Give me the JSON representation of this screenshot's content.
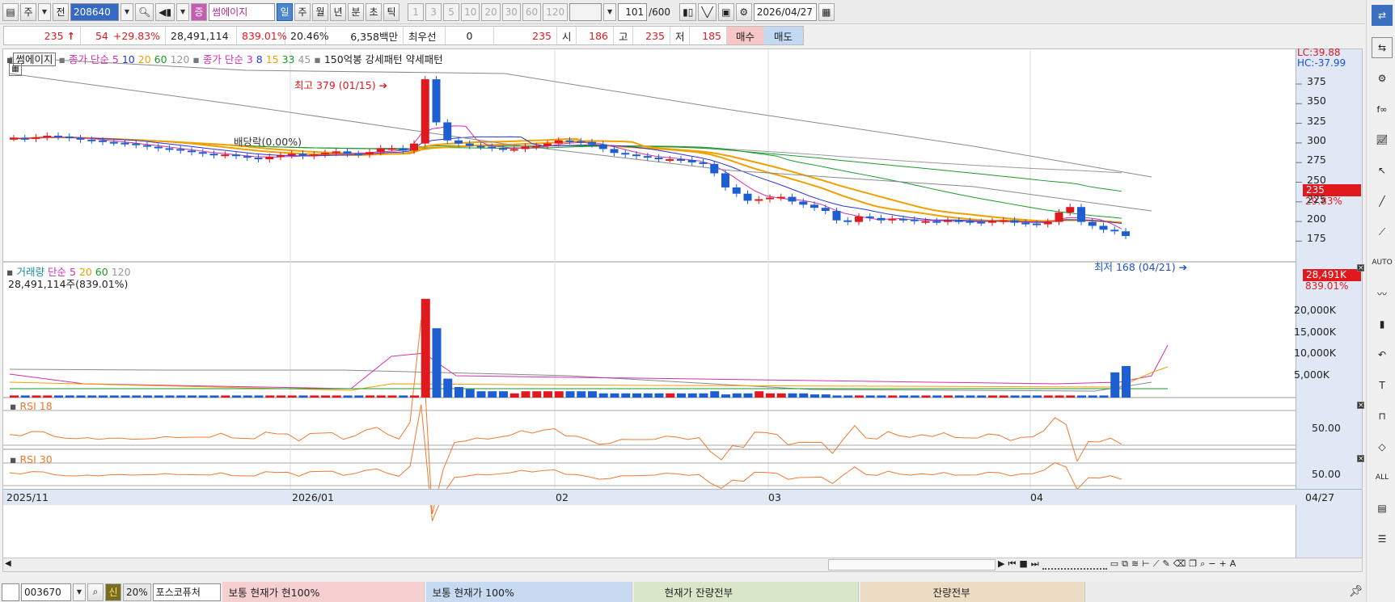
{
  "toolbar": {
    "market": "주",
    "prev": "전",
    "code": "208640",
    "stock_badge": "증",
    "stock_name": "썸에이지",
    "period_buttons": [
      "일",
      "주",
      "월",
      "년",
      "분",
      "초",
      "틱"
    ],
    "active_period": "일",
    "minutes": [
      "1",
      "3",
      "5",
      "10",
      "20",
      "30",
      "60",
      "120"
    ],
    "count": "101",
    "total": "/600",
    "date": "2026/04/27"
  },
  "info": {
    "price": "235",
    "arrow": "↑",
    "change": "54",
    "rate": "+29.83%",
    "volume": "28,491,114",
    "vol_rate": "839.01%",
    "turnover": "20.46%",
    "amount": "6,358백만",
    "kind": "최우선",
    "preferred": "0",
    "ask": "235",
    "open_label": "시",
    "open": "186",
    "high_label": "고",
    "high": "235",
    "low_label": "저",
    "low": "185",
    "buy": "매수",
    "sell": "매도"
  },
  "price_panel": {
    "name": "썸에이지",
    "ma_label": "종가 단순",
    "ma": [
      "5",
      "10",
      "20",
      "60",
      "120"
    ],
    "ma2_label": "종가 단순",
    "ma2": [
      "3",
      "8",
      "15",
      "33",
      "45"
    ],
    "pattern": "150억봉 강세패턴",
    "weak": "약세패턴",
    "lc": "LC:39.88",
    "hc": "HC:-37.99",
    "high_note": "최고 379 (01/15)",
    "low_note": "최저 168 (04/21)",
    "div_note": "배당락(0.00%)",
    "current": "235",
    "current_rate": "29.83%",
    "ticks": [
      "375",
      "350",
      "325",
      "300",
      "275",
      "250",
      "225",
      "200",
      "175"
    ]
  },
  "volume_panel": {
    "name": "거래량",
    "ma_label": "단순",
    "ma": [
      "5",
      "20",
      "60",
      "120"
    ],
    "value": "28,491,114주(839.01%)",
    "current": "28,491K",
    "current_rate": "839.01%",
    "ticks": [
      "20,000K",
      "15,000K",
      "10,000K",
      "5,000K"
    ]
  },
  "rsi1": {
    "name": "RSI 18",
    "tick": "50.00"
  },
  "rsi2": {
    "name": "RSI 30",
    "tick": "50.00"
  },
  "xaxis": {
    "labels": [
      "2025/11",
      "2026/01",
      "02",
      "03",
      "04"
    ],
    "last": "04/27"
  },
  "bottom": {
    "code": "003670",
    "badge": "신",
    "pct": "20%",
    "name": "포스코퓨처",
    "seg1": "보통  현재가  현100%",
    "seg2": "보통  현재가  100%",
    "seg3": "현재가  잔량전부",
    "seg4": "잔량전부"
  }
}
